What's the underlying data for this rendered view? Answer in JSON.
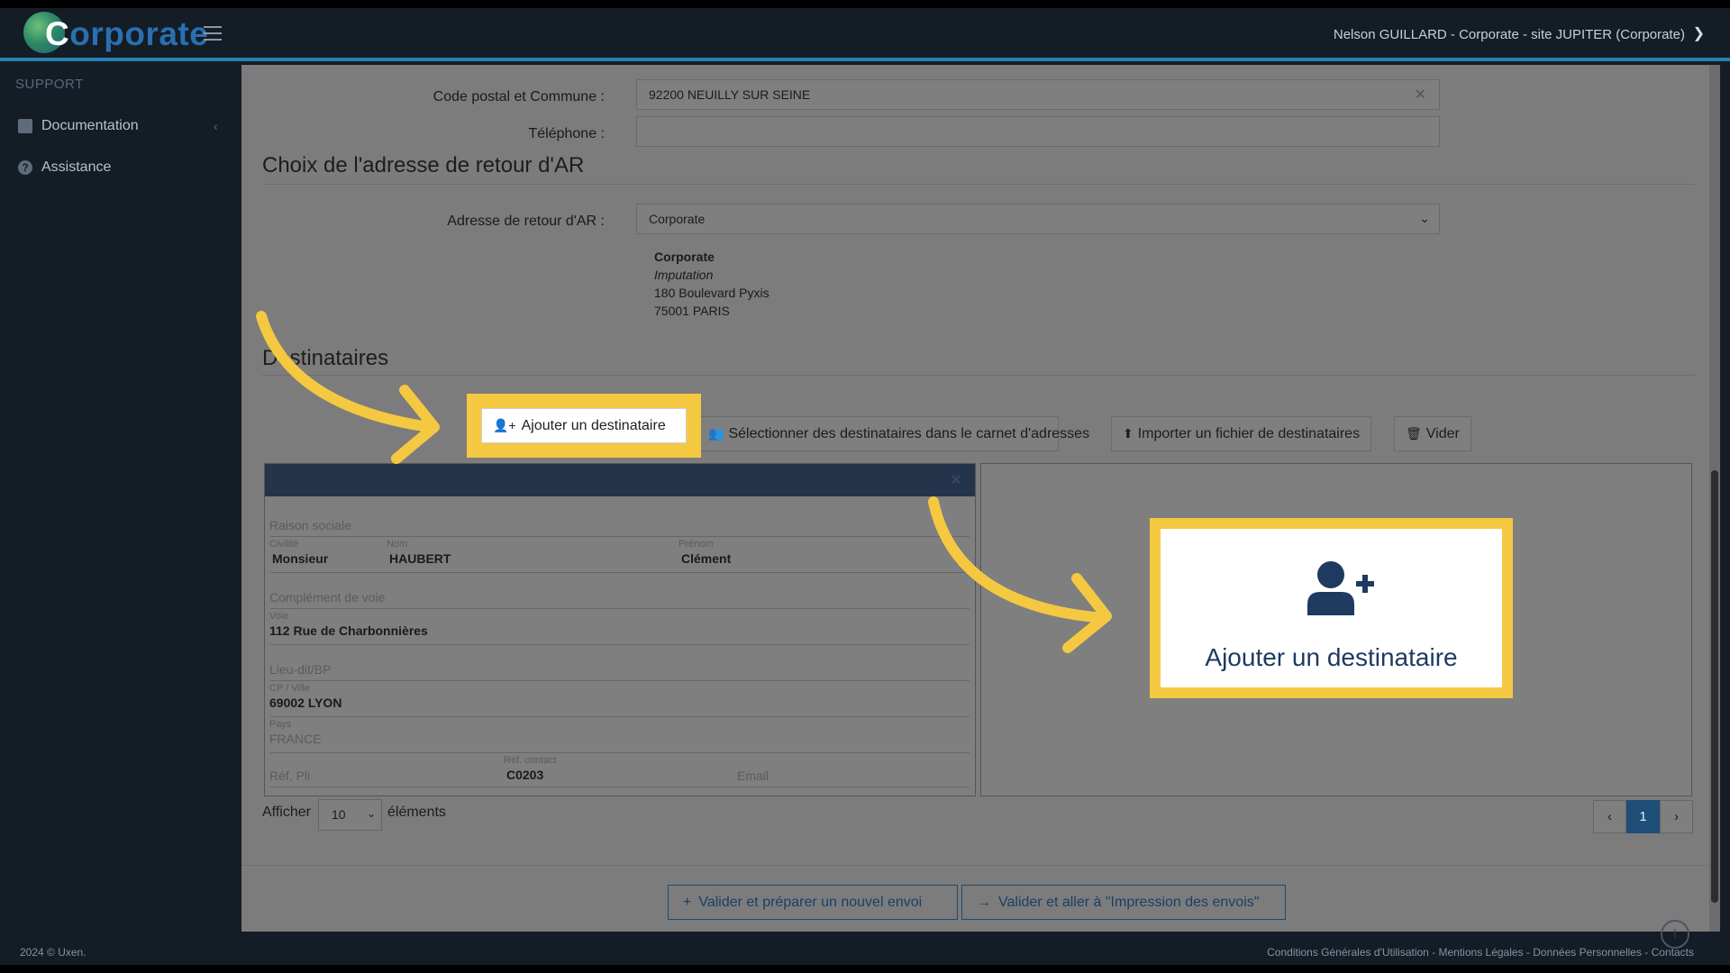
{
  "brand": {
    "logo_first": "C",
    "logo_rest": "orporate"
  },
  "header": {
    "user_label": "Nelson GUILLARD - Corporate - site JUPITER (Corporate)"
  },
  "sidebar": {
    "section": "SUPPORT",
    "items": [
      {
        "label": "Documentation",
        "icon": "book-icon"
      },
      {
        "label": "Assistance",
        "icon": "question-circle-icon"
      }
    ]
  },
  "form": {
    "postal_label": "Code postal et Commune :",
    "postal_value": "92200 NEUILLY SUR SEINE",
    "phone_label": "Téléphone :",
    "phone_value": "",
    "ar_section_title": "Choix de l'adresse de retour d'AR",
    "ar_label": "Adresse de retour d'AR :",
    "ar_selected": "Corporate",
    "ar_address": {
      "name": "Corporate",
      "imputation": "Imputation",
      "street": "180 Boulevard Pyxis",
      "city": "75001 PARIS"
    }
  },
  "recipients": {
    "section_title": "Destinataires",
    "buttons": {
      "add": "Ajouter un destinataire",
      "select": "Sélectionner des destinataires dans le carnet d'adresses",
      "import": "Importer un fichier de destinataires",
      "clear": "Vider"
    },
    "card": {
      "raison_sociale_label": "Raison sociale",
      "civilite_label": "Civilité",
      "civilite_value": "Monsieur",
      "nom_label": "Nom",
      "nom_value": "HAUBERT",
      "prenom_label": "Prénom",
      "prenom_value": "Clément",
      "complement_label": "Complément de voie",
      "voie_label": "Voie",
      "voie_value": "112 Rue de Charbonnières",
      "lieudit_label": "Lieu-dit/BP",
      "cpville_label": "CP / Ville",
      "cpville_value": "69002 LYON",
      "pays_label": "Pays",
      "pays_value": "FRANCE",
      "refpli_label": "Réf. Pli",
      "refcontact_label": "Réf. contact",
      "refcontact_value": "C0203",
      "email_label": "Email"
    },
    "zoom_label": "Ajouter un destinataire",
    "pagination": {
      "show_label": "Afficher",
      "per_page": "10",
      "elements_label": "éléments",
      "prev": "‹",
      "current": "1",
      "next": "›"
    }
  },
  "actions": {
    "validate_new": "Valider et préparer un nouvel envoi",
    "validate_print": "Valider et aller à \"Impression des envois\""
  },
  "footer": {
    "copyright": "2024 © Uxen.",
    "links": "Conditions Générales d'Utilisation - Mentions Légales - Données Personnelles - Contacts"
  },
  "colors": {
    "highlight": "#f5c842",
    "accent": "#2b7fb0",
    "primary": "#1f4e78"
  }
}
